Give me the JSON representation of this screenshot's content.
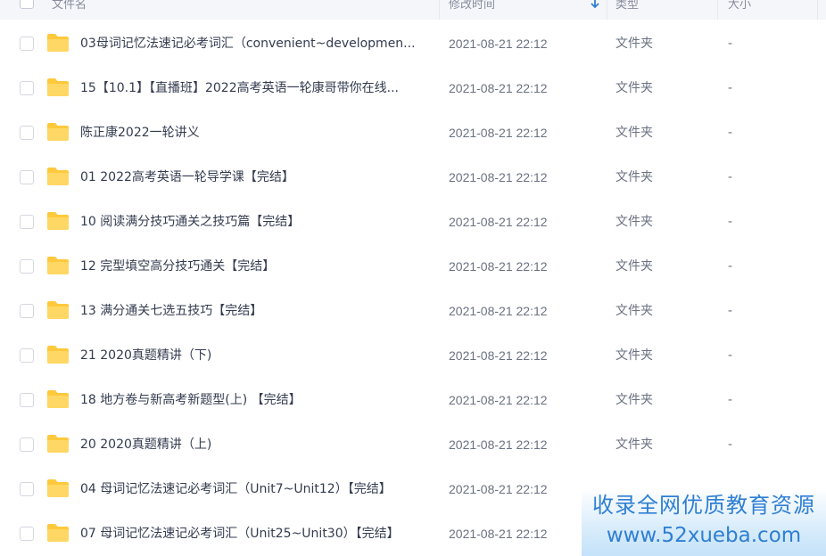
{
  "header": {
    "name_label": "文件名",
    "time_label": "修改时间",
    "type_label": "类型",
    "size_label": "大小"
  },
  "rows": [
    {
      "name": "03母词记忆法速记必考词汇（convenient~developmen...",
      "time": "2021-08-21 22:12",
      "type": "文件夹",
      "size": "-"
    },
    {
      "name": "15【10.1】【直播班】2022高考英语一轮康哥带你在线...",
      "time": "2021-08-21 22:12",
      "type": "文件夹",
      "size": "-"
    },
    {
      "name": "陈正康2022一轮讲义",
      "time": "2021-08-21 22:12",
      "type": "文件夹",
      "size": "-"
    },
    {
      "name": "01 2022高考英语一轮导学课【完结】",
      "time": "2021-08-21 22:12",
      "type": "文件夹",
      "size": "-"
    },
    {
      "name": "10 阅读满分技巧通关之技巧篇【完结】",
      "time": "2021-08-21 22:12",
      "type": "文件夹",
      "size": "-"
    },
    {
      "name": "12 完型填空高分技巧通关【完结】",
      "time": "2021-08-21 22:12",
      "type": "文件夹",
      "size": "-"
    },
    {
      "name": "13 满分通关七选五技巧【完结】",
      "time": "2021-08-21 22:12",
      "type": "文件夹",
      "size": "-"
    },
    {
      "name": "21 2020真题精讲（下)",
      "time": "2021-08-21 22:12",
      "type": "文件夹",
      "size": "-"
    },
    {
      "name": "18 地方卷与新高考新题型(上) 【完结】",
      "time": "2021-08-21 22:12",
      "type": "文件夹",
      "size": "-"
    },
    {
      "name": "20 2020真题精讲（上)",
      "time": "2021-08-21 22:12",
      "type": "文件夹",
      "size": "-"
    },
    {
      "name": "04 母词记忆法速记必考词汇（Unit7~Unit12）【完结】",
      "time": "2021-08-21 22:12",
      "type": "",
      "size": ""
    },
    {
      "name": "07 母词记忆法速记必考词汇（Unit25~Unit30）【完结】",
      "time": "2021-08-21 22:12",
      "type": "",
      "size": ""
    }
  ],
  "watermark": {
    "line1": "收录全网优质教育资源",
    "line2": "www.52xueba.com"
  },
  "colors": {
    "folder": "#ffc93d",
    "accent": "#2f7fd3",
    "header_bg": "#f5f6fa"
  }
}
